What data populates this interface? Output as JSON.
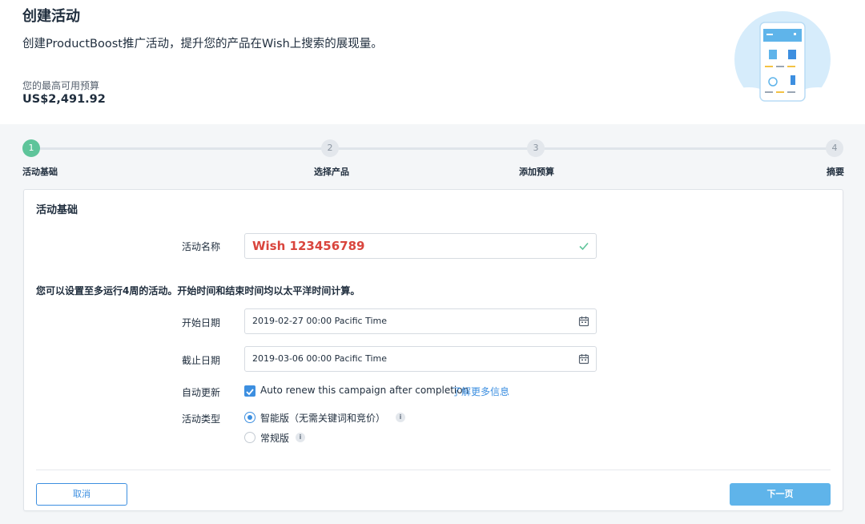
{
  "header": {
    "title": "创建活动",
    "description": "创建ProductBoost推广活动，提升您的产品在Wish上搜索的展现量。",
    "budget_label": "您的最高可用预算",
    "budget_value": "US$2,491.92"
  },
  "stepper": {
    "steps": [
      {
        "number": "1",
        "label": "活动基础",
        "active": true
      },
      {
        "number": "2",
        "label": "选择产品",
        "active": false
      },
      {
        "number": "3",
        "label": "添加预算",
        "active": false
      },
      {
        "number": "4",
        "label": "摘要",
        "active": false
      }
    ]
  },
  "form": {
    "section_title": "活动基础",
    "campaign_name_label": "活动名称",
    "campaign_name_value": "Wish 123456789",
    "info_text": "您可以设置至多运行4周的活动。开始时间和结束时间均以太平洋时间计算。",
    "start_date_label": "开始日期",
    "start_date_value": "2019-02-27 00:00 Pacific Time",
    "end_date_label": "截止日期",
    "end_date_value": "2019-03-06 00:00 Pacific Time",
    "auto_renew_label": "自动更新",
    "auto_renew_text": "Auto renew this campaign after completion",
    "auto_renew_checked": true,
    "learn_more_link": "了解更多信息",
    "campaign_type_label": "活动类型",
    "type_smart": "智能版（无需关键词和竞价）",
    "type_standard": "常规版",
    "selected_type": "smart"
  },
  "actions": {
    "cancel_label": "取消",
    "next_label": "下一页"
  },
  "colors": {
    "accent": "#3d8fe0",
    "step_active": "#5ec49a",
    "name_text": "#d9453d",
    "next_button": "#5fb4ea"
  }
}
